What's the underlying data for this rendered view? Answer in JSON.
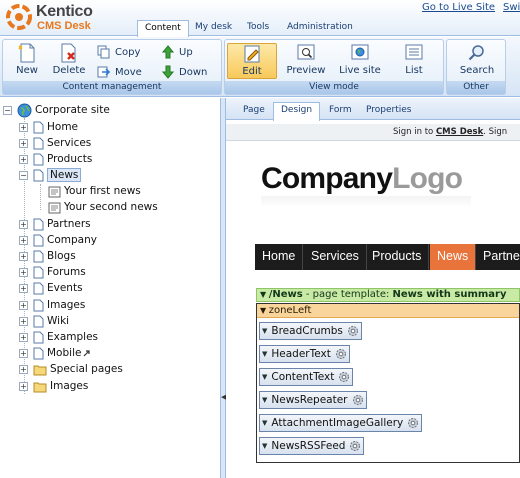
{
  "header": {
    "brand": "Kentico",
    "brand_sub": "CMS Desk",
    "links": {
      "live": "Go to Live Site",
      "switch": "Swi"
    },
    "tabs": [
      "Content",
      "My desk",
      "Tools",
      "Administration"
    ],
    "active_tab": "Content"
  },
  "toolbar": {
    "content_management": {
      "caption": "Content management",
      "new": "New",
      "delete": "Delete",
      "copy": "Copy",
      "move": "Move",
      "up": "Up",
      "down": "Down"
    },
    "view_mode": {
      "caption": "View mode",
      "edit": "Edit",
      "preview": "Preview",
      "live_site": "Live site",
      "list": "List",
      "selected": "Edit"
    },
    "other": {
      "caption": "Other",
      "search": "Search"
    }
  },
  "tree": {
    "root": "Corporate site",
    "selected": "News",
    "nodes": [
      {
        "label": "Home"
      },
      {
        "label": "Services"
      },
      {
        "label": "Products"
      },
      {
        "label": "News",
        "expanded": true
      },
      {
        "label": "Your first news",
        "child": true
      },
      {
        "label": "Your second news",
        "child": true
      },
      {
        "label": "Partners"
      },
      {
        "label": "Company"
      },
      {
        "label": "Blogs"
      },
      {
        "label": "Forums"
      },
      {
        "label": "Events"
      },
      {
        "label": "Images"
      },
      {
        "label": "Wiki"
      },
      {
        "label": "Examples"
      },
      {
        "label": "Mobile"
      },
      {
        "label": "Special pages",
        "folder": true
      },
      {
        "label": "Images",
        "folder": true
      }
    ]
  },
  "editor": {
    "tabs": [
      "Page",
      "Design",
      "Form",
      "Properties"
    ],
    "active_tab": "Design",
    "signin": {
      "prefix": "Sign in to",
      "link": "CMS Desk",
      "suffix": ". Sign"
    },
    "company_logo": {
      "part1": "Company",
      "part2": "Logo"
    },
    "site_nav": [
      "Home",
      "Services",
      "Products",
      "News",
      "Partne"
    ],
    "site_nav_active": "News",
    "template": {
      "path": "/News",
      "middle": " - page template: ",
      "name": "News with summary"
    },
    "zone": "zoneLeft",
    "webparts": [
      "BreadCrumbs",
      "HeaderText",
      "ContentText",
      "NewsRepeater",
      "AttachmentImageGallery",
      "NewsRSSFeed"
    ]
  },
  "colors": {
    "accent_orange": "#e8743b",
    "toolbar_blue": "#9fbde3",
    "template_green": "#c8eaa5",
    "zone_orange": "#f9d59b"
  }
}
